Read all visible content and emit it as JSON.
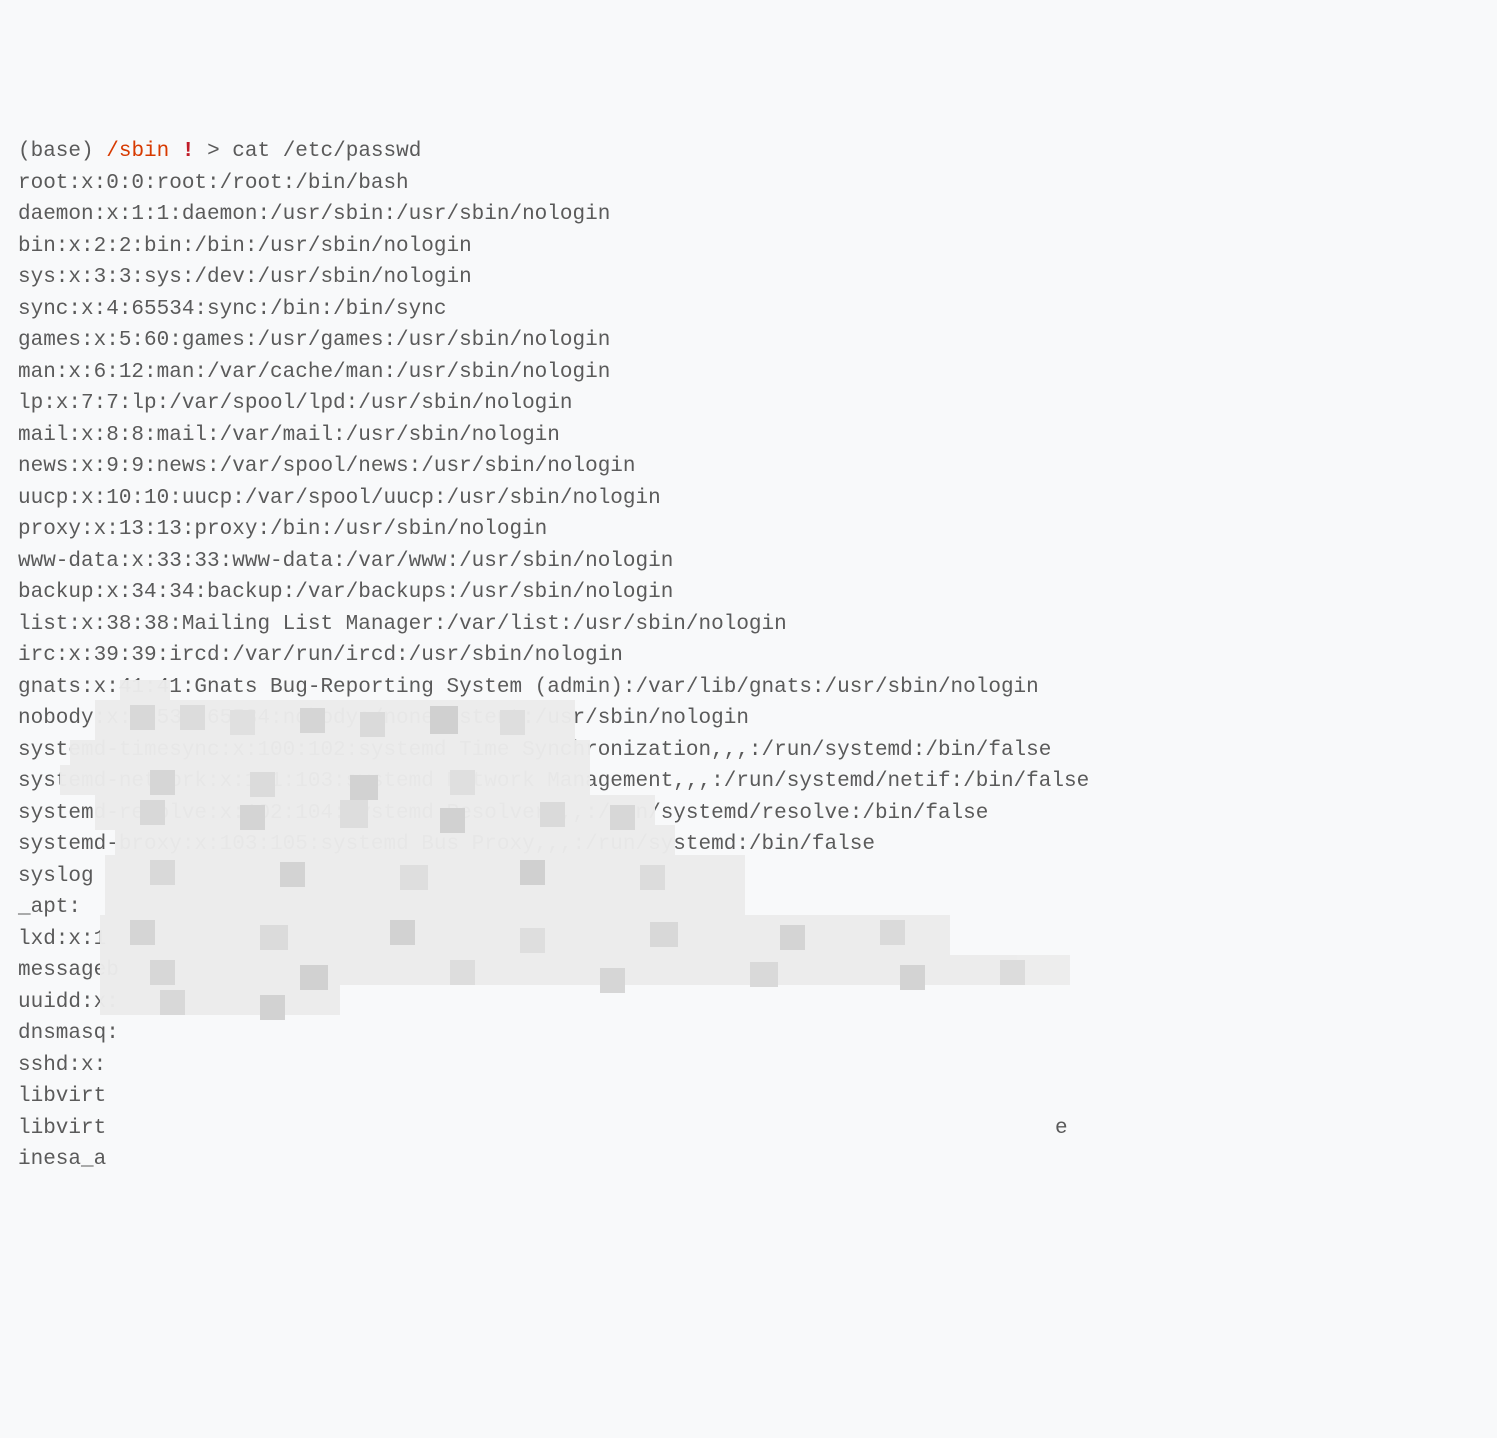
{
  "prompt": {
    "env": "(base)",
    "path": "/sbin",
    "bang": "!",
    "arrow": ">",
    "command": "cat /etc/passwd"
  },
  "output": [
    "root:x:0:0:root:/root:/bin/bash",
    "daemon:x:1:1:daemon:/usr/sbin:/usr/sbin/nologin",
    "bin:x:2:2:bin:/bin:/usr/sbin/nologin",
    "sys:x:3:3:sys:/dev:/usr/sbin/nologin",
    "sync:x:4:65534:sync:/bin:/bin/sync",
    "games:x:5:60:games:/usr/games:/usr/sbin/nologin",
    "man:x:6:12:man:/var/cache/man:/usr/sbin/nologin",
    "lp:x:7:7:lp:/var/spool/lpd:/usr/sbin/nologin",
    "mail:x:8:8:mail:/var/mail:/usr/sbin/nologin",
    "news:x:9:9:news:/var/spool/news:/usr/sbin/nologin",
    "uucp:x:10:10:uucp:/var/spool/uucp:/usr/sbin/nologin",
    "proxy:x:13:13:proxy:/bin:/usr/sbin/nologin",
    "www-data:x:33:33:www-data:/var/www:/usr/sbin/nologin",
    "backup:x:34:34:backup:/var/backups:/usr/sbin/nologin",
    "list:x:38:38:Mailing List Manager:/var/list:/usr/sbin/nologin",
    "irc:x:39:39:ircd:/var/run/ircd:/usr/sbin/nologin",
    "gnats:x:41:41:Gnats Bug-Reporting System (admin):/var/lib/gnats:/usr/sbin/nologin",
    "nobody:x:65534:65534:nobody:/nonexistent:/usr/sbin/nologin",
    "systemd-timesync:x:100:102:systemd Time Synchronization,,,:/run/systemd:/bin/false",
    "systemd-network:x:101:103:systemd Network Management,,,:/run/systemd/netif:/bin/false",
    "systemd-resolve:x:102:104:systemd Resolver,,,:/run/systemd/resolve:/bin/false",
    "systemd-bus-proxy:x:103:105:systemd Bus Proxy,,,:/run/systemd:/bin/false",
    "syslog",
    "_apt:",
    "lxd:x:1",
    "messageb",
    "uuidd:x:",
    "dnsmasq:",
    "sshd:x:",
    "libvirt",
    "libvirt",
    "inesa_a"
  ],
  "partial_visible_chars": {
    "line21_partial": "systemd-b",
    "line21_rest": "roxy:x:103:105:systemd Bus Proxy,,,:/run/systemd:/bin/false",
    "line30_trail": "e"
  }
}
